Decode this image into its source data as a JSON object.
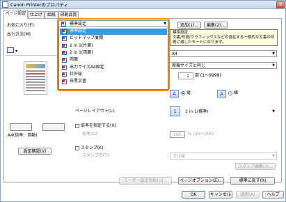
{
  "window": {
    "title": "Canon Printerのプロパティ",
    "close_glyph": "✕"
  },
  "tabs": [
    {
      "label": "ページ設定",
      "active": true
    },
    {
      "label": "仕上げ",
      "active": false
    },
    {
      "label": "給紙",
      "active": false
    },
    {
      "label": "印刷品質",
      "active": false
    }
  ],
  "favorites": {
    "label": "お気に入り(F):",
    "selected": "標準設定",
    "add_label": "追加(1)...",
    "edit_label": "編集(2)..."
  },
  "output_method": {
    "label": "出力方法(M):"
  },
  "tooltip": {
    "title": "標準設定",
    "text": "文書/写真/グラフィックスなどの混在する一般的な文書の印刷に適したモードになります。"
  },
  "favorites_options": [
    {
      "label": "標準設定",
      "selected": true
    },
    {
      "label": "ビットマップ展開",
      "selected": false
    },
    {
      "label": "2 in 1(片面)",
      "selected": false
    },
    {
      "label": "2 in 1(両面)",
      "selected": false
    },
    {
      "label": "両面",
      "selected": false
    },
    {
      "label": "出力サイズA4固定",
      "selected": false
    },
    {
      "label": "社外秘",
      "selected": false
    },
    {
      "label": "白黒文書",
      "selected": false
    }
  ],
  "page_size": {
    "value": "A4"
  },
  "output_size": {
    "value": "原稿サイズと同じ"
  },
  "copies": {
    "value": "1",
    "range": "部 (1～9999)"
  },
  "orientation": {
    "portrait": {
      "glyph": "A",
      "label": "縦",
      "selected": true
    },
    "landscape": {
      "glyph": "A",
      "label": "横",
      "selected": false
    }
  },
  "page_layout": {
    "label": "ページレイアウト(L):",
    "value": "1 in 1(標準)",
    "glyph": "1"
  },
  "scaling": {
    "label": "倍率を指定する(X)",
    "sub_label": "倍率(O):",
    "value": "100",
    "range": "% (25～200)"
  },
  "stamp": {
    "label": "スタンプ(K)",
    "sub_label": "スタンプ名(T):",
    "value": "マル秘",
    "edit_label": "スタンプ編集(3)..."
  },
  "preview": {
    "caption": "A4(倍率：自動)",
    "view_button": "設定確認(V)"
  },
  "bottom_buttons": {
    "custom_paper": "ユーザー設定用紙(U)...",
    "page_options": "ページオプション(E)...",
    "restore_defaults": "標準に戻す(R)"
  },
  "dialog_buttons": {
    "ok": "OK",
    "cancel": "キャンセル",
    "apply": "適用(A)",
    "help": "ヘルプ"
  }
}
